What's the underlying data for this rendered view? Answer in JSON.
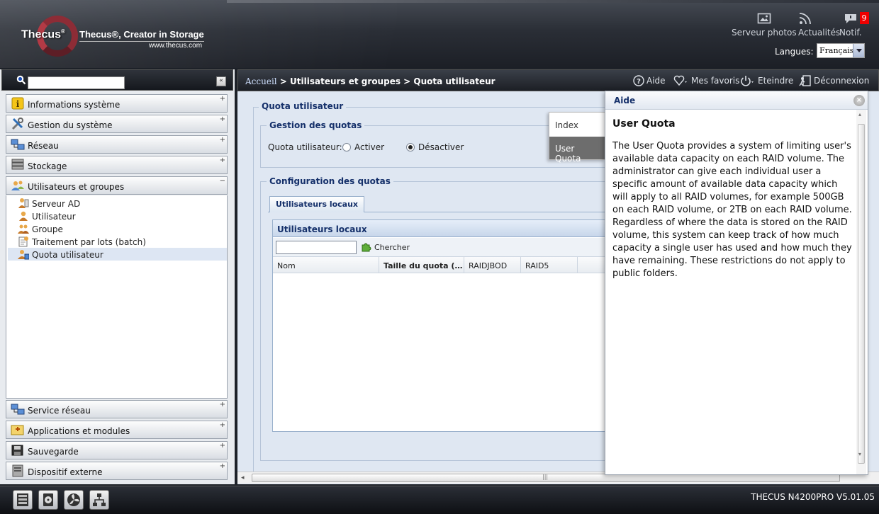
{
  "header": {
    "brand_word": "Thecus",
    "brand_mark": "®",
    "tagline": "Thecus®, Creator in Storage",
    "url": "www.thecus.com",
    "buttons": [
      {
        "label": "Serveur photos",
        "icon": "photo-icon"
      },
      {
        "label": "Actualités",
        "icon": "rss-icon"
      },
      {
        "label": "Notif.",
        "icon": "chat-bubble-icon",
        "badge": "9"
      }
    ],
    "language_label": "Langues:",
    "language_value": "Français"
  },
  "sidebar": {
    "search_placeholder": "",
    "collapse_glyph": "«",
    "sections": [
      {
        "label": "Informations système",
        "icon": "info-icon",
        "toggle": "+"
      },
      {
        "label": "Gestion du système",
        "icon": "tools-icon",
        "toggle": "+"
      },
      {
        "label": "Réseau",
        "icon": "network-icon",
        "toggle": "+"
      },
      {
        "label": "Stockage",
        "icon": "storage-icon",
        "toggle": "+"
      },
      {
        "label": "Utilisateurs et groupes",
        "icon": "users-icon",
        "toggle": "−"
      },
      {
        "label": "Service réseau",
        "icon": "network-service-icon",
        "toggle": "+"
      },
      {
        "label": "Applications et modules",
        "icon": "apps-icon",
        "toggle": "+"
      },
      {
        "label": "Sauvegarde",
        "icon": "backup-icon",
        "toggle": "+"
      },
      {
        "label": "Dispositif externe",
        "icon": "external-device-icon",
        "toggle": "+"
      }
    ],
    "sub_items": [
      {
        "label": "Serveur AD",
        "icon": "ad-server-icon",
        "selected": false
      },
      {
        "label": "Utilisateur",
        "icon": "user-icon",
        "selected": false
      },
      {
        "label": "Groupe",
        "icon": "group-icon",
        "selected": false
      },
      {
        "label": "Traitement par lots (batch)",
        "icon": "batch-icon",
        "selected": false
      },
      {
        "label": "Quota utilisateur",
        "icon": "quota-icon",
        "selected": true
      }
    ]
  },
  "breadcrumb": {
    "home": "Accueil",
    "path": " > Utilisateurs et groupes > Quota utilisateur"
  },
  "toolbar": {
    "help": "Aide",
    "favorites": "Mes favoris",
    "shutdown": "Eteindre",
    "logout": "Déconnexion"
  },
  "quota": {
    "section_title": "Quota utilisateur",
    "management_title": "Gestion des quotas",
    "field_label": "Quota utilisateur:",
    "option_enable": "Activer",
    "option_disable": "Désactiver",
    "selected_option": "disable",
    "config_title": "Configuration des quotas",
    "tab_label": "Utilisateurs locaux",
    "grid_title": "Utilisateurs locaux",
    "search_value": "",
    "search_button": "Chercher",
    "columns": [
      "Nom",
      "Taille du quota (…",
      "RAIDJBOD",
      "RAID5"
    ]
  },
  "index_menu": {
    "items": [
      {
        "label": "Index",
        "active": false
      },
      {
        "label": "User Quota",
        "active": true
      }
    ]
  },
  "help_panel": {
    "title": "Aide",
    "close_glyph": "×",
    "heading": "User Quota",
    "body": "The User Quota provides a system of limiting user's available data capacity on each RAID volume. The administrator can give each individual user a specific amount of available data capacity which will apply to all RAID volumes, for example 500GB on each RAID volume, or 2TB on each RAID volume. Regardless of where the data is stored on the RAID volume, this system can keep track of how much capacity a single user has used and how much they have remaining. These restrictions do not apply to public folders."
  },
  "footer": {
    "buttons": [
      {
        "icon": "server-icon"
      },
      {
        "icon": "disk-icon"
      },
      {
        "icon": "fan-icon"
      },
      {
        "icon": "network-tree-icon"
      }
    ],
    "version": "THECUS N4200PRO V5.01.05"
  },
  "colors": {
    "header_bg": "#2a2e36",
    "accent_red": "#8d2c36",
    "badge_red": "#e00000",
    "title_blue": "#15306a",
    "content_bg": "#dfe7f2",
    "index_active": "#6d6d6d"
  }
}
